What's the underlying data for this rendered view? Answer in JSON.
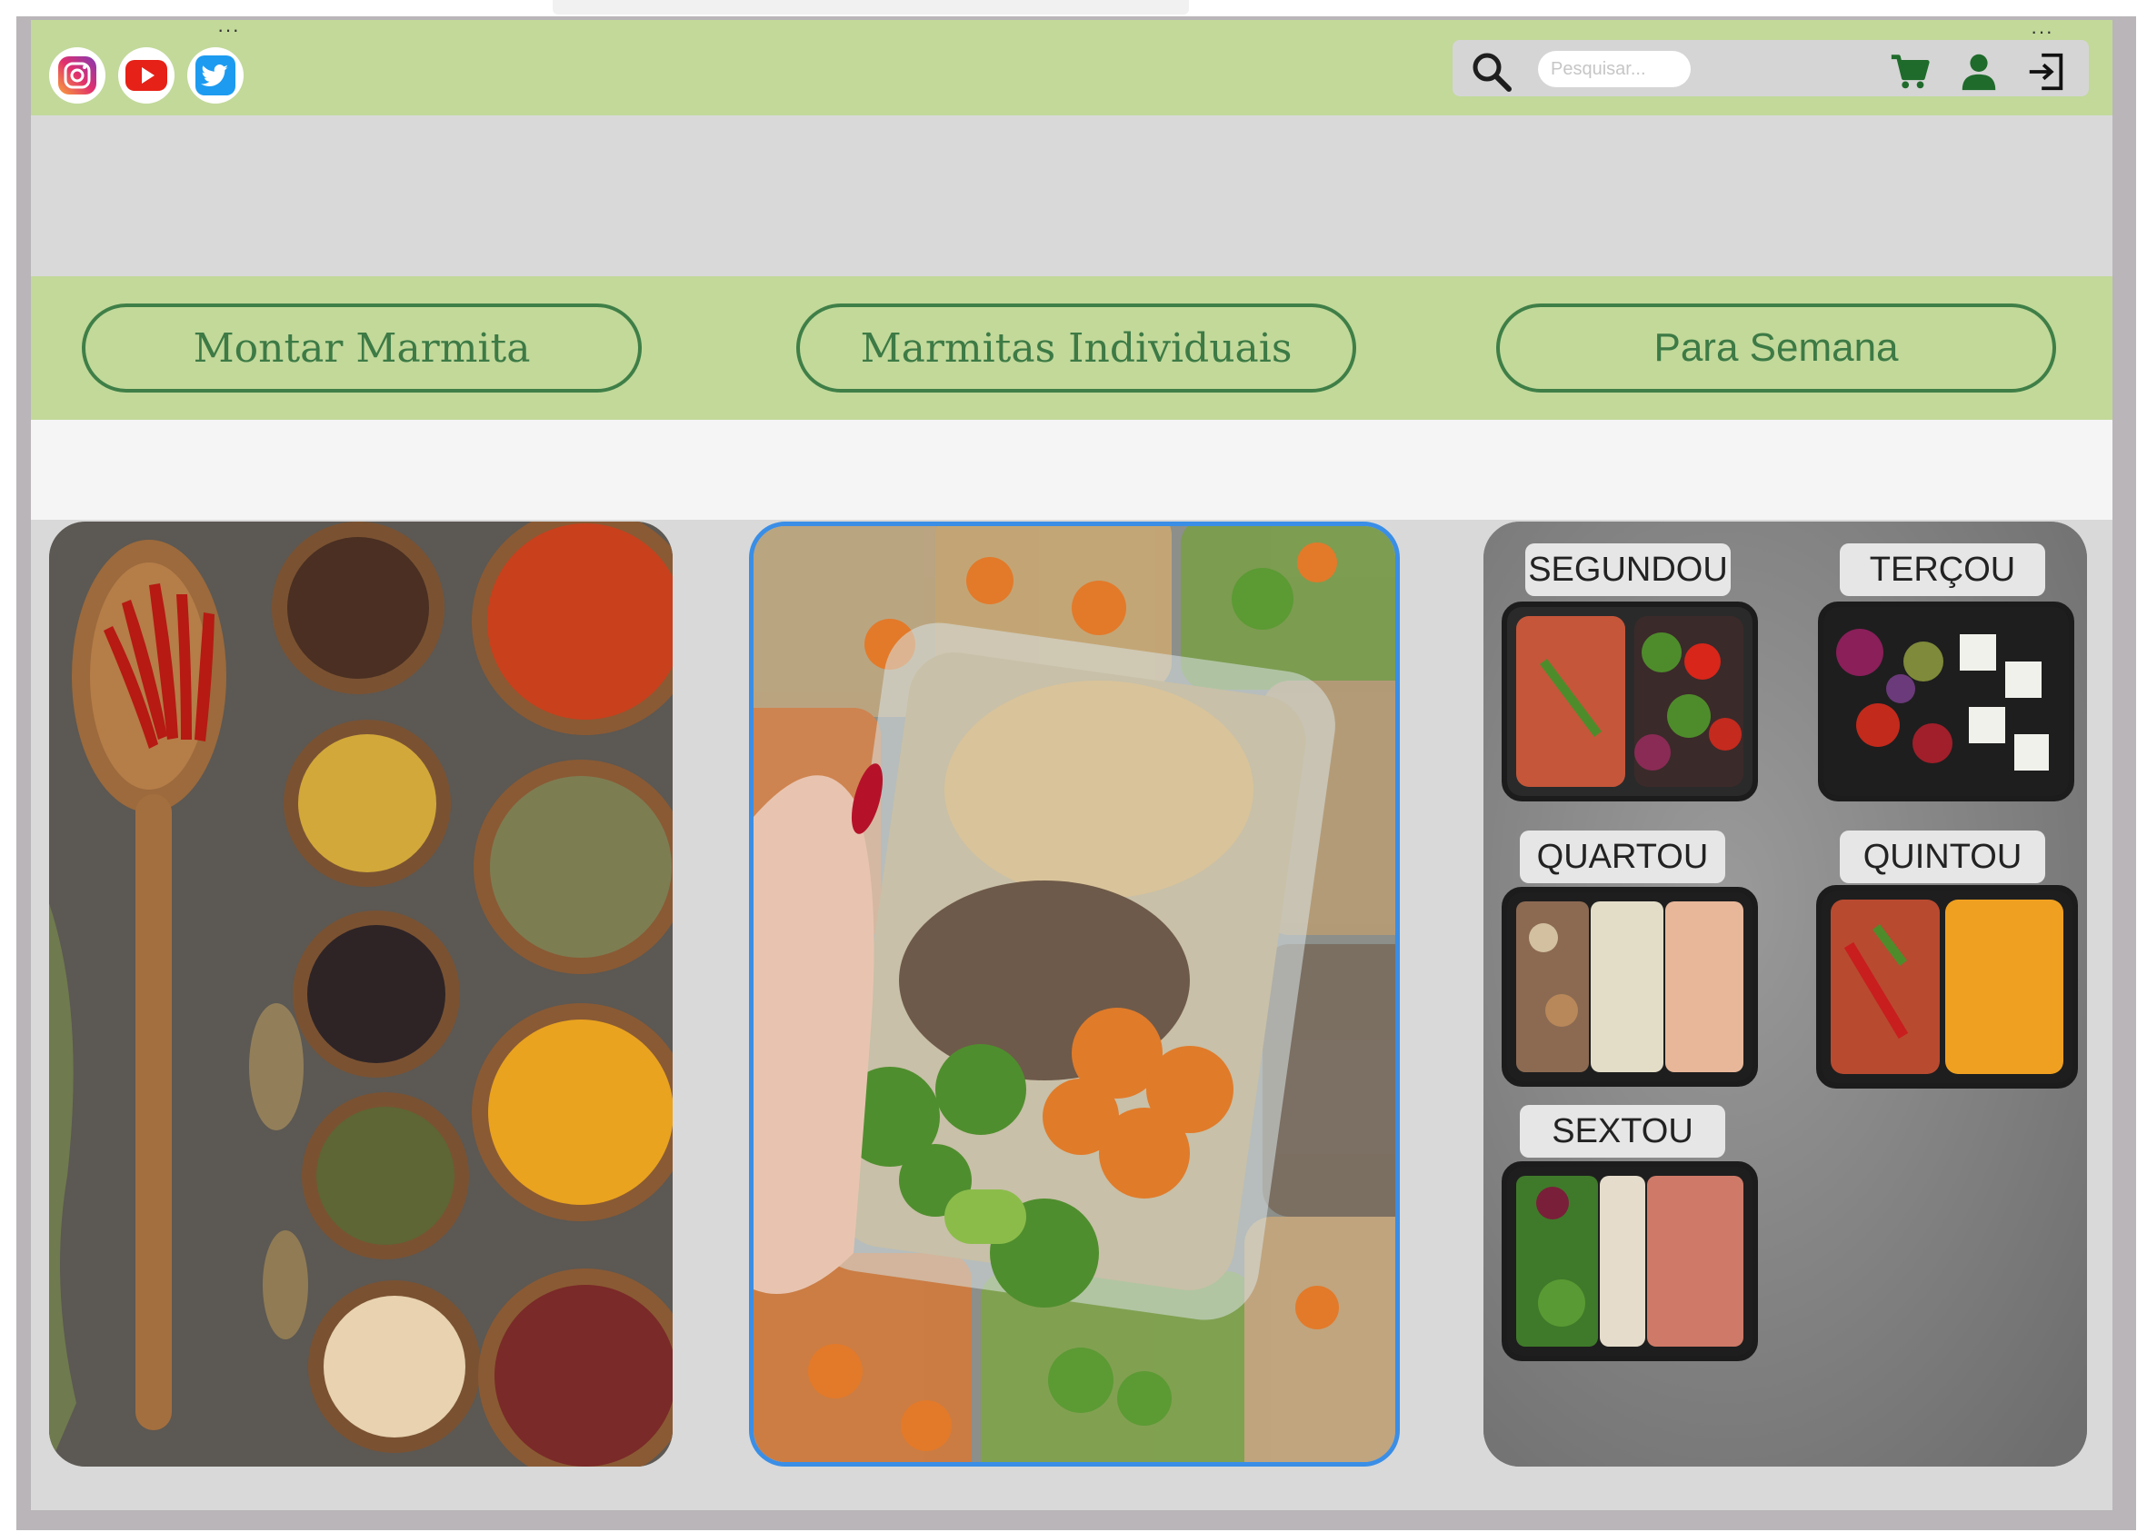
{
  "header": {
    "search_placeholder": "Pesquisar...",
    "social_icons": [
      "instagram-icon",
      "youtube-icon",
      "twitter-icon"
    ],
    "actions": [
      "cart-icon",
      "user-icon",
      "login-icon"
    ]
  },
  "nav": {
    "buttons": [
      {
        "label": "Montar Marmita"
      },
      {
        "label": "Marmitas Individuais"
      },
      {
        "label": "Para Semana"
      }
    ]
  },
  "week": {
    "days": [
      {
        "label": "SEGUNDOU"
      },
      {
        "label": "TERÇOU"
      },
      {
        "label": "QUARTOU"
      },
      {
        "label": "QUINTOU"
      },
      {
        "label": "SEXTOU"
      }
    ]
  },
  "colors": {
    "header_green": "#c2d99a",
    "button_green": "#3f7f47",
    "selected_border": "#3a8ee6",
    "page_gray": "#d9d9d9"
  }
}
